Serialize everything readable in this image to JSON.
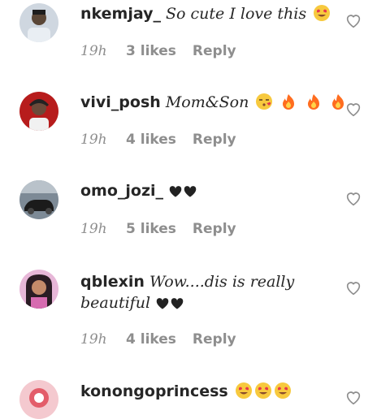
{
  "comments": [
    {
      "user": "nkemjay_",
      "text": "So cute I love this",
      "time": "19h",
      "likes": "3 likes",
      "reply": "Reply"
    },
    {
      "user": "vivi_posh",
      "text": "Mom&Son",
      "time": "19h",
      "likes": "4 likes",
      "reply": "Reply"
    },
    {
      "user": "omo_jozi_",
      "text": "",
      "time": "19h",
      "likes": "5 likes",
      "reply": "Reply"
    },
    {
      "user": "qblexin",
      "text": "Wow....dis is really beautiful",
      "time": "19h",
      "likes": "4 likes",
      "reply": "Reply"
    },
    {
      "user": "konongoprincess",
      "text": ""
    }
  ],
  "colors": {
    "meta": "#8e8e8e",
    "username": "#262626",
    "heart_outline": "#8e8e8e"
  }
}
